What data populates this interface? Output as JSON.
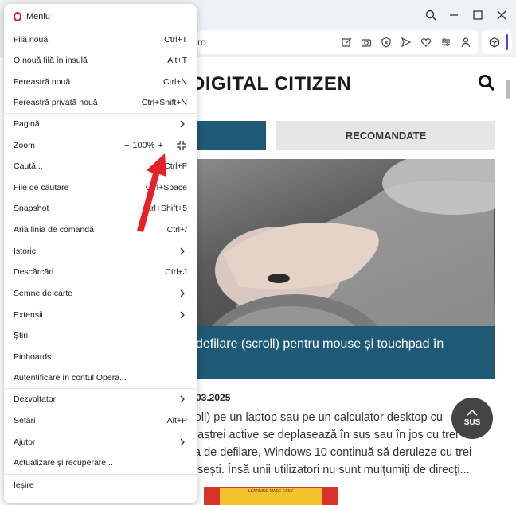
{
  "browser": {
    "address_text": "ro",
    "page_logo": "DIGITAL CITIZEN",
    "tab_reco": "RECOMANDATE",
    "caption": "defilare (scroll) pentru mouse și touchpad în",
    "date": "03.2025",
    "article_lines": [
      "roll) pe un laptop sau pe un calculator desktop cu",
      "eastrei active se deplasează în sus sau în jos cu trei",
      "ța de defilare, Windows 10 continuă să deruleze cu trei",
      "osești. Însă unii utilizatori nu sunt mulțumiți de direcți..."
    ],
    "scroll_top_label": "SUS",
    "bottom_banner_text": "LEARNING MADE EASY"
  },
  "menu": {
    "title": "Meniu",
    "items": [
      {
        "label": "Filă nouă",
        "shortcut": "Ctrl+T"
      },
      {
        "label": "O nouă filă în insulă",
        "shortcut": "Alt+T"
      },
      {
        "label": "Fereastră nouă",
        "shortcut": "Ctrl+N"
      },
      {
        "label": "Fereastră privată nouă",
        "shortcut": "Ctrl+Shift+N"
      },
      {
        "label": "Pagină",
        "shortcut": ""
      },
      {
        "label": "Zoom",
        "shortcut": ""
      },
      {
        "label": "Caută...",
        "shortcut": "Ctrl+F"
      },
      {
        "label": "File de căutare",
        "shortcut": "Ctrl+Space"
      },
      {
        "label": "Snapshot",
        "shortcut": "Ctrl+Shift+5"
      },
      {
        "label": "Aria linia de comandă",
        "shortcut": "Ctrl+/"
      },
      {
        "label": "Istoric",
        "shortcut": ""
      },
      {
        "label": "Descărcări",
        "shortcut": "Ctrl+J"
      },
      {
        "label": "Semne de carte",
        "shortcut": ""
      },
      {
        "label": "Extensii",
        "shortcut": ""
      },
      {
        "label": "Știri",
        "shortcut": ""
      },
      {
        "label": "Pinboards",
        "shortcut": ""
      },
      {
        "label": "Autentificare în contul Opera...",
        "shortcut": ""
      },
      {
        "label": "Dezvoltator",
        "shortcut": ""
      },
      {
        "label": "Setări",
        "shortcut": "Alt+P"
      },
      {
        "label": "Ajutor",
        "shortcut": ""
      },
      {
        "label": "Actualizare și recuperare...",
        "shortcut": ""
      },
      {
        "label": "Ieșire",
        "shortcut": ""
      }
    ],
    "zoom": {
      "minus": "−",
      "value": "100%",
      "plus": "+"
    }
  },
  "colors": {
    "accent": "#1e5a78",
    "opera_red": "#e0162b",
    "arrow_red": "#e8202a"
  },
  "icons": [
    "search-icon",
    "minimize-icon",
    "maximize-icon",
    "close-icon",
    "edit-icon",
    "camera-icon",
    "shield-icon",
    "send-icon",
    "heart-icon",
    "easy-setup-icon",
    "account-icon",
    "cube-icon",
    "fullscreen-icon",
    "chevron-right-icon",
    "chevron-up-icon"
  ]
}
